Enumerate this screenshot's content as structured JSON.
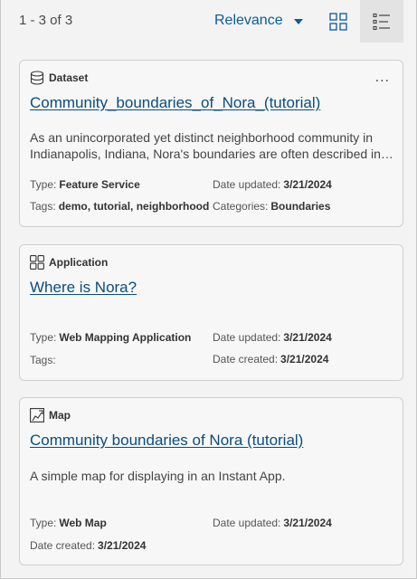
{
  "toolbar": {
    "result_count": "1 - 3 of 3",
    "sort_label": "Relevance"
  },
  "icons": {
    "dataset": "database-icon",
    "application": "app-grid-icon",
    "map": "map-icon",
    "view_grid": "grid-view-icon",
    "view_list": "list-view-icon"
  },
  "colors": {
    "link": "#0b4d7d",
    "accent": "#0b5c94"
  },
  "cards": [
    {
      "type_label": "Dataset",
      "title": "Community_boundaries_of_Nora_(tutorial)",
      "more": "...",
      "description": "As an unincorporated yet distinct neighborhood community in Indianapolis, Indiana, Nora's boundaries are often described in…",
      "type_key": "Type:",
      "type_value": "Feature Service",
      "updated_key": "Date updated:",
      "updated_value": "3/21/2024",
      "tags_key": "Tags:",
      "tags_value": "demo, tutorial, neighborhood",
      "categories_key": "Categories:",
      "categories_value": "Boundaries"
    },
    {
      "type_label": "Application",
      "title": "Where is Nora?",
      "type_key": "Type:",
      "type_value": "Web Mapping Application",
      "updated_key": "Date updated:",
      "updated_value": "3/21/2024",
      "tags_key": "Tags:",
      "created_key": "Date created:",
      "created_value": "3/21/2024"
    },
    {
      "type_label": "Map",
      "title": "Community boundaries of Nora (tutorial)",
      "description": "A simple map for displaying in an Instant App.",
      "type_key": "Type:",
      "type_value": "Web Map",
      "updated_key": "Date updated:",
      "updated_value": "3/21/2024",
      "created_key": "Date created:",
      "created_value": "3/21/2024"
    }
  ]
}
